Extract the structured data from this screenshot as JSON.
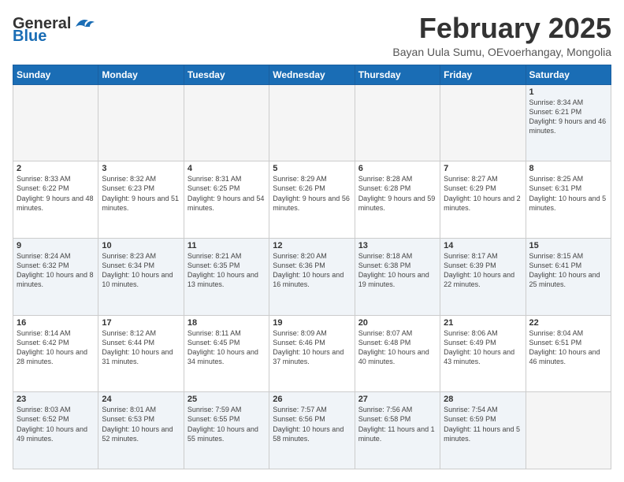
{
  "header": {
    "logo_general": "General",
    "logo_blue": "Blue",
    "month": "February 2025",
    "location": "Bayan Uula Sumu, OEvoerhangay, Mongolia"
  },
  "days_of_week": [
    "Sunday",
    "Monday",
    "Tuesday",
    "Wednesday",
    "Thursday",
    "Friday",
    "Saturday"
  ],
  "weeks": [
    [
      {
        "num": "",
        "info": "",
        "empty": true
      },
      {
        "num": "",
        "info": "",
        "empty": true
      },
      {
        "num": "",
        "info": "",
        "empty": true
      },
      {
        "num": "",
        "info": "",
        "empty": true
      },
      {
        "num": "",
        "info": "",
        "empty": true
      },
      {
        "num": "",
        "info": "",
        "empty": true
      },
      {
        "num": "1",
        "info": "Sunrise: 8:34 AM\nSunset: 6:21 PM\nDaylight: 9 hours\nand 46 minutes."
      }
    ],
    [
      {
        "num": "2",
        "info": "Sunrise: 8:33 AM\nSunset: 6:22 PM\nDaylight: 9 hours\nand 48 minutes."
      },
      {
        "num": "3",
        "info": "Sunrise: 8:32 AM\nSunset: 6:23 PM\nDaylight: 9 hours\nand 51 minutes."
      },
      {
        "num": "4",
        "info": "Sunrise: 8:31 AM\nSunset: 6:25 PM\nDaylight: 9 hours\nand 54 minutes."
      },
      {
        "num": "5",
        "info": "Sunrise: 8:29 AM\nSunset: 6:26 PM\nDaylight: 9 hours\nand 56 minutes."
      },
      {
        "num": "6",
        "info": "Sunrise: 8:28 AM\nSunset: 6:28 PM\nDaylight: 9 hours\nand 59 minutes."
      },
      {
        "num": "7",
        "info": "Sunrise: 8:27 AM\nSunset: 6:29 PM\nDaylight: 10 hours\nand 2 minutes."
      },
      {
        "num": "8",
        "info": "Sunrise: 8:25 AM\nSunset: 6:31 PM\nDaylight: 10 hours\nand 5 minutes."
      }
    ],
    [
      {
        "num": "9",
        "info": "Sunrise: 8:24 AM\nSunset: 6:32 PM\nDaylight: 10 hours\nand 8 minutes."
      },
      {
        "num": "10",
        "info": "Sunrise: 8:23 AM\nSunset: 6:34 PM\nDaylight: 10 hours\nand 10 minutes."
      },
      {
        "num": "11",
        "info": "Sunrise: 8:21 AM\nSunset: 6:35 PM\nDaylight: 10 hours\nand 13 minutes."
      },
      {
        "num": "12",
        "info": "Sunrise: 8:20 AM\nSunset: 6:36 PM\nDaylight: 10 hours\nand 16 minutes."
      },
      {
        "num": "13",
        "info": "Sunrise: 8:18 AM\nSunset: 6:38 PM\nDaylight: 10 hours\nand 19 minutes."
      },
      {
        "num": "14",
        "info": "Sunrise: 8:17 AM\nSunset: 6:39 PM\nDaylight: 10 hours\nand 22 minutes."
      },
      {
        "num": "15",
        "info": "Sunrise: 8:15 AM\nSunset: 6:41 PM\nDaylight: 10 hours\nand 25 minutes."
      }
    ],
    [
      {
        "num": "16",
        "info": "Sunrise: 8:14 AM\nSunset: 6:42 PM\nDaylight: 10 hours\nand 28 minutes."
      },
      {
        "num": "17",
        "info": "Sunrise: 8:12 AM\nSunset: 6:44 PM\nDaylight: 10 hours\nand 31 minutes."
      },
      {
        "num": "18",
        "info": "Sunrise: 8:11 AM\nSunset: 6:45 PM\nDaylight: 10 hours\nand 34 minutes."
      },
      {
        "num": "19",
        "info": "Sunrise: 8:09 AM\nSunset: 6:46 PM\nDaylight: 10 hours\nand 37 minutes."
      },
      {
        "num": "20",
        "info": "Sunrise: 8:07 AM\nSunset: 6:48 PM\nDaylight: 10 hours\nand 40 minutes."
      },
      {
        "num": "21",
        "info": "Sunrise: 8:06 AM\nSunset: 6:49 PM\nDaylight: 10 hours\nand 43 minutes."
      },
      {
        "num": "22",
        "info": "Sunrise: 8:04 AM\nSunset: 6:51 PM\nDaylight: 10 hours\nand 46 minutes."
      }
    ],
    [
      {
        "num": "23",
        "info": "Sunrise: 8:03 AM\nSunset: 6:52 PM\nDaylight: 10 hours\nand 49 minutes."
      },
      {
        "num": "24",
        "info": "Sunrise: 8:01 AM\nSunset: 6:53 PM\nDaylight: 10 hours\nand 52 minutes."
      },
      {
        "num": "25",
        "info": "Sunrise: 7:59 AM\nSunset: 6:55 PM\nDaylight: 10 hours\nand 55 minutes."
      },
      {
        "num": "26",
        "info": "Sunrise: 7:57 AM\nSunset: 6:56 PM\nDaylight: 10 hours\nand 58 minutes."
      },
      {
        "num": "27",
        "info": "Sunrise: 7:56 AM\nSunset: 6:58 PM\nDaylight: 11 hours\nand 1 minute."
      },
      {
        "num": "28",
        "info": "Sunrise: 7:54 AM\nSunset: 6:59 PM\nDaylight: 11 hours\nand 5 minutes."
      },
      {
        "num": "",
        "info": "",
        "empty": true
      }
    ]
  ]
}
